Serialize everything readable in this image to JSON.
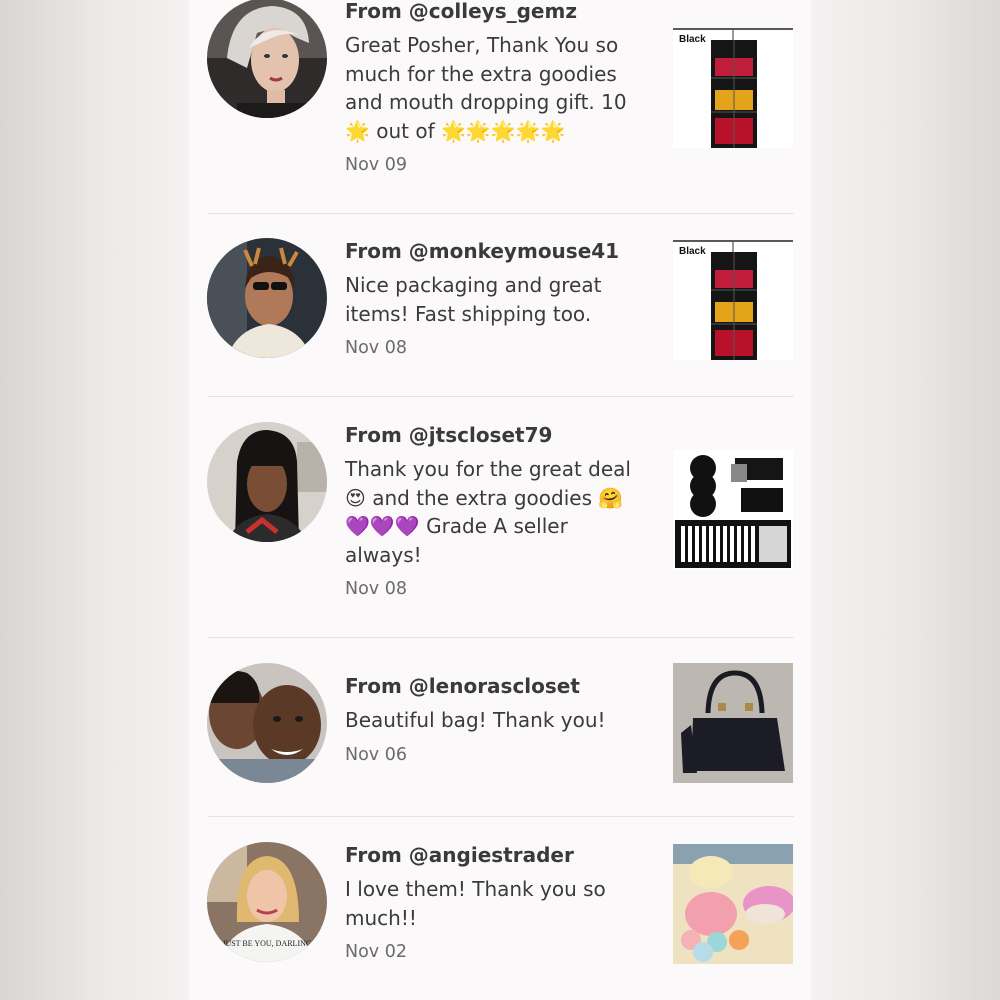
{
  "reviews": [
    {
      "from": "From @colleys_gemz",
      "message": "Great Posher, Thank You so\nmuch for the extra goodies\nand mouth dropping gift. 10\n🌟 out of 🌟🌟🌟🌟🌟",
      "date": "Nov 09",
      "thumb_label": "Black"
    },
    {
      "from": "From @monkeymouse41",
      "message": "Nice packaging and great\nitems! Fast shipping too.",
      "date": "Nov 08",
      "thumb_label": "Black"
    },
    {
      "from": "From @jtscloset79",
      "message": "Thank you for the great deal\n😍 and the extra goodies 🤗\n💜💜💜 Grade A seller\nalways!",
      "date": "Nov 08"
    },
    {
      "from": "From @lenorascloset",
      "message": "Beautiful bag! Thank you!",
      "date": "Nov 06"
    },
    {
      "from": "From @angiestrader",
      "message": "I love them! Thank you so\nmuch!!",
      "date": "Nov 02",
      "shirt_text": "JUST BE YOU, DARLING"
    }
  ],
  "colors": {
    "panel": "#fbf9f9",
    "text": "#3a3a3a",
    "date": "#6b6b6b",
    "divider": "#e6e3e3"
  }
}
